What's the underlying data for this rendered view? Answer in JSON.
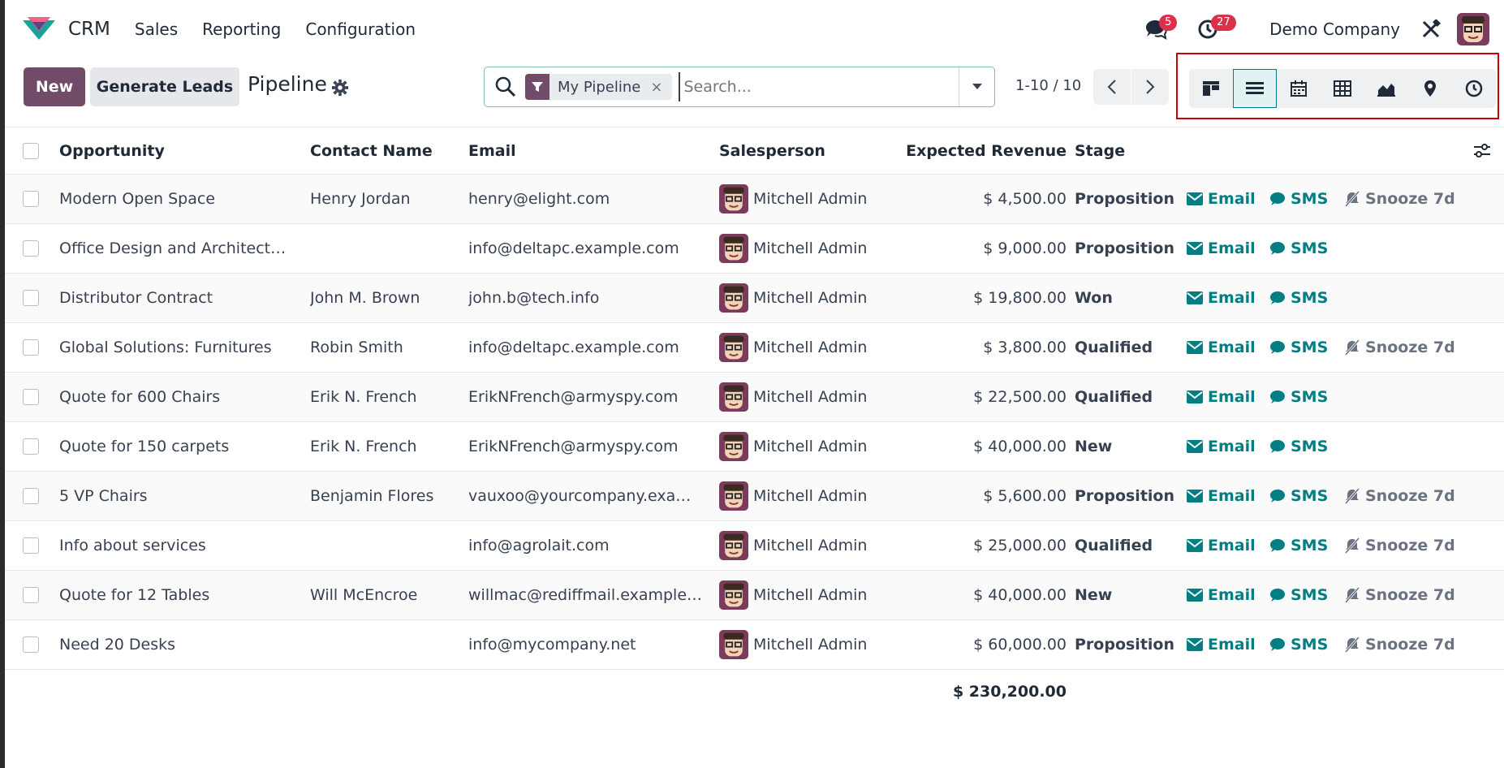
{
  "app": {
    "name": "CRM"
  },
  "menu": [
    "Sales",
    "Reporting",
    "Configuration"
  ],
  "navbar": {
    "messages_count": "5",
    "activities_count": "27",
    "company": "Demo Company"
  },
  "control": {
    "new_label": "New",
    "generate_label": "Generate Leads",
    "title": "Pipeline",
    "facet_label": "My Pipeline",
    "facet_remove": "×",
    "search_placeholder": "Search...",
    "pager": "1-10 / 10"
  },
  "views": [
    "kanban-view-icon",
    "list-view-icon",
    "calendar-view-icon",
    "pivot-view-icon",
    "graph-view-icon",
    "map-view-icon",
    "activity-view-icon"
  ],
  "columns": {
    "opportunity": "Opportunity",
    "contact": "Contact Name",
    "email": "Email",
    "salesperson": "Salesperson",
    "revenue": "Expected Revenue",
    "stage": "Stage"
  },
  "actions": {
    "email": "Email",
    "sms": "SMS",
    "snooze": "Snooze 7d"
  },
  "rows": [
    {
      "opportunity": "Modern Open Space",
      "contact": "Henry Jordan",
      "email": "henry@elight.com",
      "salesperson": "Mitchell Admin",
      "revenue": "$ 4,500.00",
      "stage": "Proposition",
      "snooze": true
    },
    {
      "opportunity": "Office Design and Architect…",
      "contact": "",
      "email": "info@deltapc.example.com",
      "salesperson": "Mitchell Admin",
      "revenue": "$ 9,000.00",
      "stage": "Proposition",
      "snooze": false
    },
    {
      "opportunity": "Distributor Contract",
      "contact": "John M. Brown",
      "email": "john.b@tech.info",
      "salesperson": "Mitchell Admin",
      "revenue": "$ 19,800.00",
      "stage": "Won",
      "snooze": false
    },
    {
      "opportunity": "Global Solutions: Furnitures",
      "contact": "Robin Smith",
      "email": "info@deltapc.example.com",
      "salesperson": "Mitchell Admin",
      "revenue": "$ 3,800.00",
      "stage": "Qualified",
      "snooze": true
    },
    {
      "opportunity": "Quote for 600 Chairs",
      "contact": "Erik N. French",
      "email": "ErikNFrench@armyspy.com",
      "salesperson": "Mitchell Admin",
      "revenue": "$ 22,500.00",
      "stage": "Qualified",
      "snooze": false
    },
    {
      "opportunity": "Quote for 150 carpets",
      "contact": "Erik N. French",
      "email": "ErikNFrench@armyspy.com",
      "salesperson": "Mitchell Admin",
      "revenue": "$ 40,000.00",
      "stage": "New",
      "snooze": false
    },
    {
      "opportunity": "5 VP Chairs",
      "contact": "Benjamin Flores",
      "email": "vauxoo@yourcompany.exa…",
      "salesperson": "Mitchell Admin",
      "revenue": "$ 5,600.00",
      "stage": "Proposition",
      "snooze": true
    },
    {
      "opportunity": "Info about services",
      "contact": "",
      "email": "info@agrolait.com",
      "salesperson": "Mitchell Admin",
      "revenue": "$ 25,000.00",
      "stage": "Qualified",
      "snooze": true
    },
    {
      "opportunity": "Quote for 12 Tables",
      "contact": "Will McEncroe",
      "email": "willmac@rediffmail.example…",
      "salesperson": "Mitchell Admin",
      "revenue": "$ 40,000.00",
      "stage": "New",
      "snooze": true
    },
    {
      "opportunity": "Need 20 Desks",
      "contact": "",
      "email": "info@mycompany.net",
      "salesperson": "Mitchell Admin",
      "revenue": "$ 60,000.00",
      "stage": "Proposition",
      "snooze": true
    }
  ],
  "total_revenue": "$ 230,200.00",
  "colors": {
    "brand": "#714b67",
    "accent": "#017e84",
    "badge": "#d9304b",
    "highlight": "#cc0000"
  }
}
